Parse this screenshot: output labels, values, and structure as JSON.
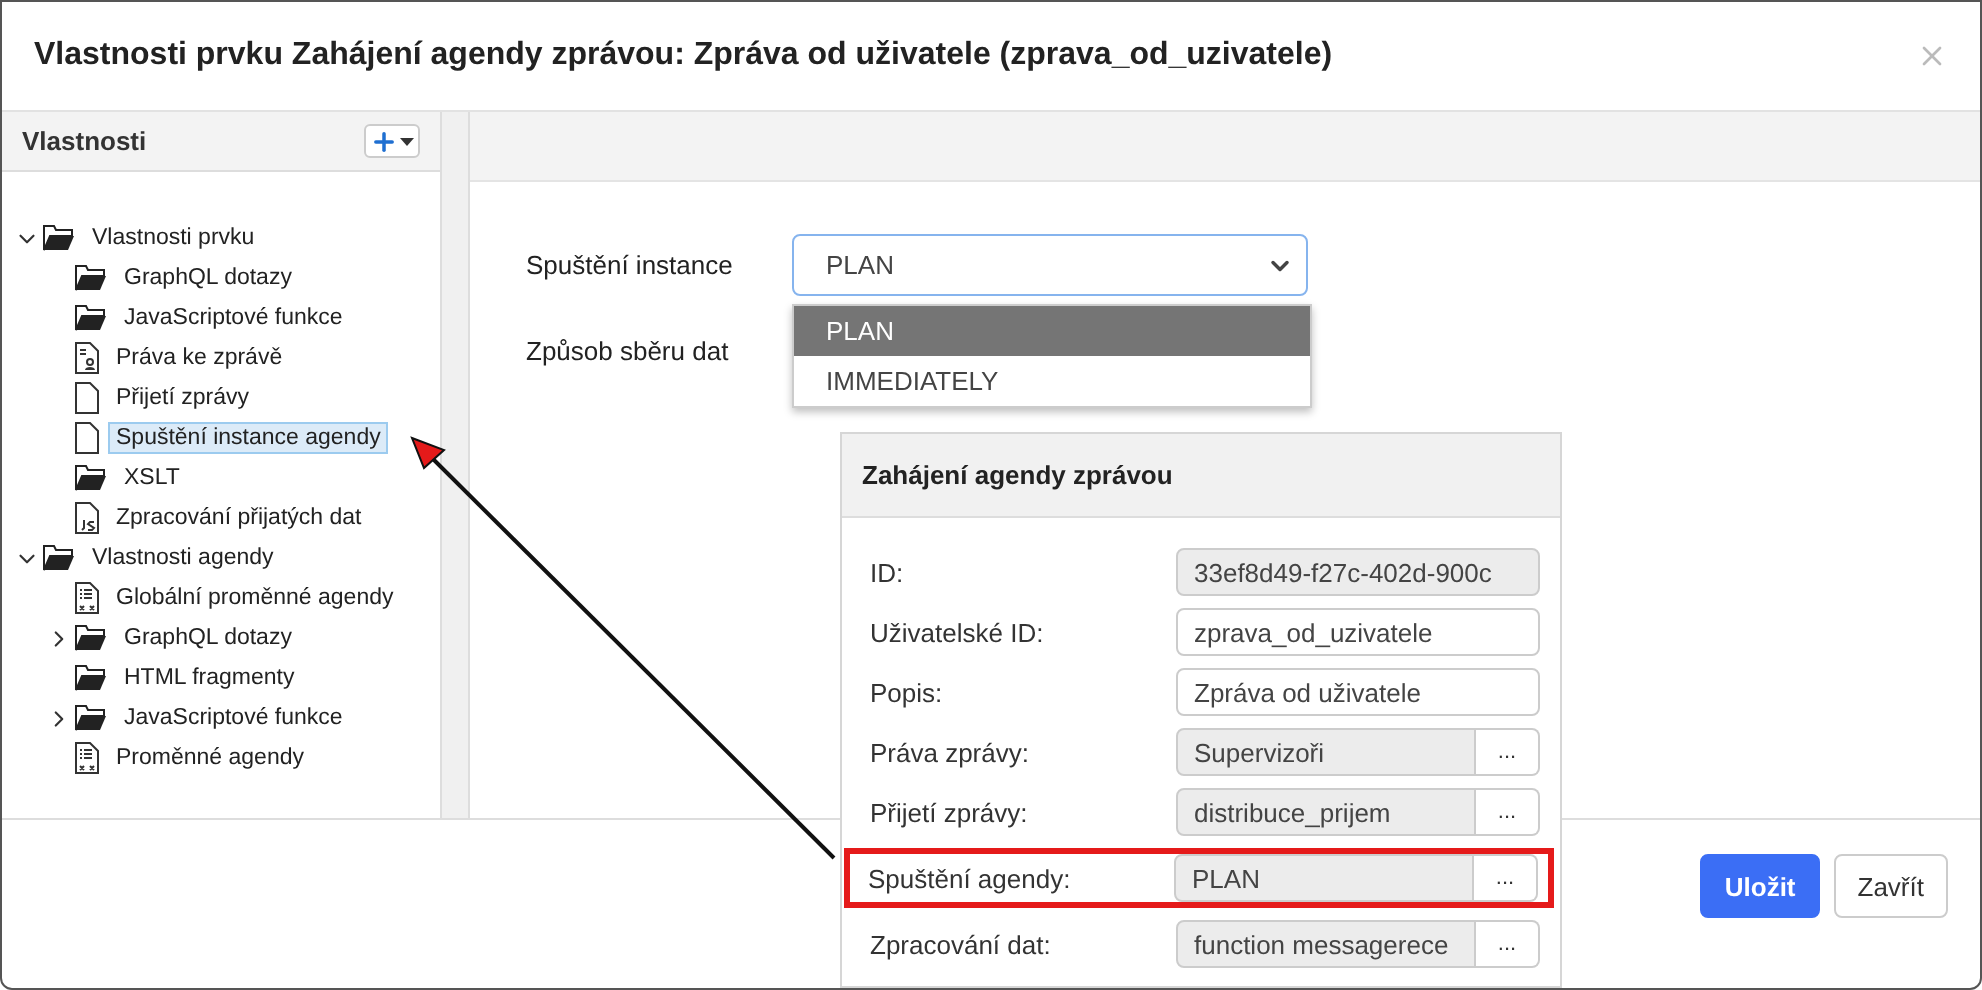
{
  "window": {
    "title": "Vlastnosti prvku Zahájení agendy zprávou: Zpráva od uživatele (zprava_od_uzivatele)"
  },
  "sidebar": {
    "title": "Vlastnosti",
    "tree": [
      {
        "label": "Vlastnosti prvku",
        "kind": "folder",
        "expanded": true,
        "selected": false,
        "children": [
          {
            "label": "GraphQL dotazy",
            "kind": "folder",
            "selected": false
          },
          {
            "label": "JavaScriptové funkce",
            "kind": "folder",
            "selected": false
          },
          {
            "label": "Práva ke zprávě",
            "kind": "rights",
            "selected": false
          },
          {
            "label": "Přijetí zprávy",
            "kind": "document",
            "selected": false
          },
          {
            "label": "Spuštění instance agendy",
            "kind": "document",
            "selected": true
          },
          {
            "label": "XSLT",
            "kind": "folder",
            "selected": false
          },
          {
            "label": "Zpracování přijatých dat",
            "kind": "script",
            "selected": false
          }
        ]
      },
      {
        "label": "Vlastnosti agendy",
        "kind": "folder",
        "expanded": true,
        "selected": false,
        "children": [
          {
            "label": "Globální proměnné agendy",
            "kind": "variables",
            "selected": false
          },
          {
            "label": "GraphQL dotazy",
            "kind": "folder",
            "expanded": false,
            "selected": false
          },
          {
            "label": "HTML fragmenty",
            "kind": "folder",
            "selected": false
          },
          {
            "label": "JavaScriptové funkce",
            "kind": "folder",
            "expanded": false,
            "selected": false
          },
          {
            "label": "Proměnné agendy",
            "kind": "variables",
            "selected": false
          }
        ]
      }
    ]
  },
  "form": {
    "fields": [
      {
        "label": "Spuštění instance",
        "kind": "select",
        "value": "PLAN",
        "open": true,
        "options": [
          {
            "label": "PLAN",
            "selected": true
          },
          {
            "label": "IMMEDIATELY",
            "selected": false
          }
        ]
      },
      {
        "label": "Způsob sběru dat",
        "kind": "label"
      }
    ]
  },
  "inset": {
    "title": "Zahájení agendy zprávou",
    "rows": [
      {
        "label": "ID:",
        "value": "33ef8d49-f27c-402d-900c",
        "readonly": true,
        "highlighted": false
      },
      {
        "label": "Uživatelské ID:",
        "value": "zprava_od_uzivatele",
        "readonly": false,
        "highlighted": false
      },
      {
        "label": "Popis:",
        "value": "Zpráva od uživatele",
        "readonly": false,
        "highlighted": false
      },
      {
        "label": "Práva zprávy:",
        "value": "Supervizoři",
        "readonly": true,
        "button": "...",
        "highlighted": false
      },
      {
        "label": "Přijetí zprávy:",
        "value": "distribuce_prijem",
        "readonly": true,
        "button": "...",
        "highlighted": false
      },
      {
        "label": "Spuštění agendy:",
        "value": "PLAN",
        "readonly": true,
        "button": "...",
        "highlighted": true
      },
      {
        "label": "Zpracování dat:",
        "value": "function messagerece",
        "readonly": true,
        "button": "...",
        "highlighted": false
      }
    ]
  },
  "footer": {
    "buttons": [
      {
        "label": "Uložit",
        "kind": "primary"
      },
      {
        "label": "Zavřít",
        "kind": "secondary"
      }
    ]
  }
}
